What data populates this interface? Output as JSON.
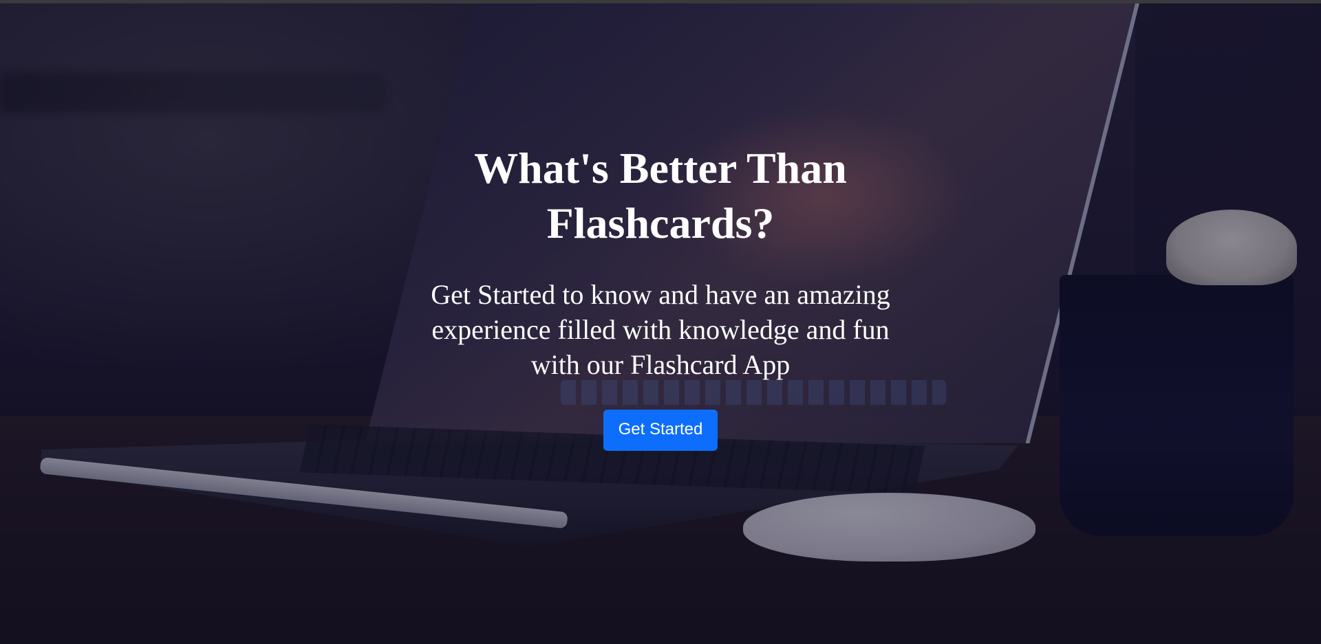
{
  "hero": {
    "title": "What's Better Than Flashcards?",
    "subtitle": "Get Started to know and have an amazing experience filled with knowledge and fun with our Flashcard App",
    "cta_label": "Get Started",
    "background_image": "laptop-on-desk-photo"
  },
  "colors": {
    "primary_button": "#0d6efd",
    "text": "#ffffff",
    "overlay": "rgba(10,10,40,0.45)"
  }
}
